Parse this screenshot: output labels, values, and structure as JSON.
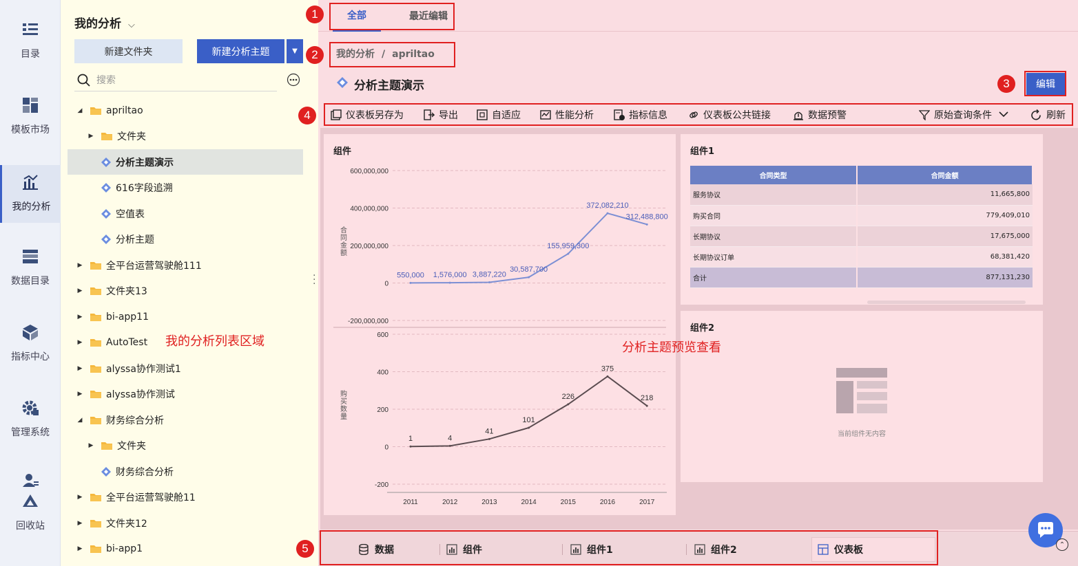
{
  "nav": {
    "items": [
      {
        "label": "目录",
        "icon": "list-icon"
      },
      {
        "label": "模板市场",
        "icon": "template-grid-icon"
      },
      {
        "label": "我的分析",
        "icon": "analysis-chart-icon",
        "active": true
      },
      {
        "label": "数据目录",
        "icon": "database-catalog-icon"
      },
      {
        "label": "指标中心",
        "icon": "metrics-cube-icon"
      },
      {
        "label": "管理系统",
        "icon": "gear-icon"
      },
      {
        "label": "回收站",
        "icon": "recycle-bin-icon"
      }
    ]
  },
  "panel": {
    "title": "我的分析",
    "new_folder_label": "新建文件夹",
    "new_subject_label": "新建分析主题",
    "search_placeholder": "搜索",
    "region_annotation": "我的分析列表区域",
    "tree": [
      {
        "label": "apriltao",
        "type": "folder",
        "expanded": true,
        "depth": 0
      },
      {
        "label": "文件夹",
        "type": "folder",
        "expanded": false,
        "depth": 1
      },
      {
        "label": "分析主题演示",
        "type": "subject",
        "selected": true,
        "depth": 1
      },
      {
        "label": "616字段追溯",
        "type": "subject",
        "depth": 1
      },
      {
        "label": "空值表",
        "type": "subject",
        "depth": 1
      },
      {
        "label": "分析主题",
        "type": "subject",
        "depth": 1
      },
      {
        "label": "全平台运营驾驶舱111",
        "type": "folder",
        "expanded": false,
        "depth": 0
      },
      {
        "label": "文件夹13",
        "type": "folder",
        "expanded": false,
        "depth": 0
      },
      {
        "label": "bi-app11",
        "type": "folder",
        "expanded": false,
        "depth": 0
      },
      {
        "label": "AutoTest",
        "type": "folder",
        "expanded": false,
        "depth": 0
      },
      {
        "label": "alyssa协作测试1",
        "type": "folder",
        "expanded": false,
        "depth": 0
      },
      {
        "label": "alyssa协作测试",
        "type": "folder",
        "expanded": false,
        "depth": 0
      },
      {
        "label": "财务综合分析",
        "type": "folder",
        "expanded": true,
        "depth": 0
      },
      {
        "label": "文件夹",
        "type": "folder",
        "expanded": false,
        "depth": 1
      },
      {
        "label": "财务综合分析",
        "type": "subject",
        "depth": 1
      },
      {
        "label": "全平台运营驾驶舱11",
        "type": "folder",
        "expanded": false,
        "depth": 0
      },
      {
        "label": "文件夹12",
        "type": "folder",
        "expanded": false,
        "depth": 0
      },
      {
        "label": "bi-app1",
        "type": "folder",
        "expanded": false,
        "depth": 0
      }
    ]
  },
  "tabs": [
    {
      "label": "全部",
      "active": true
    },
    {
      "label": "最近编辑",
      "active": false
    }
  ],
  "breadcrumb": {
    "root": "我的分析",
    "sep": "/",
    "current": "apriltao"
  },
  "subject_title": "分析主题演示",
  "edit_label": "编辑",
  "toolbar": {
    "items": [
      {
        "label": "仪表板另存为",
        "icon": "save-as-icon"
      },
      {
        "label": "导出",
        "icon": "export-icon"
      },
      {
        "label": "自适应",
        "icon": "fit-screen-icon"
      },
      {
        "label": "性能分析",
        "icon": "performance-icon"
      },
      {
        "label": "指标信息",
        "icon": "metric-info-icon"
      },
      {
        "label": "仪表板公共链接",
        "icon": "link-icon"
      },
      {
        "label": "数据预警",
        "icon": "alarm-icon"
      }
    ],
    "filter_label": "原始查询条件",
    "refresh_label": "刷新"
  },
  "preview_annotation": "分析主题预览查看",
  "widget_chart": {
    "title": "组件"
  },
  "widget_table": {
    "title": "组件1",
    "headers": [
      "合同类型",
      "合同金额"
    ],
    "rows": [
      [
        "服务协议",
        "11,665,800"
      ],
      [
        "购买合同",
        "779,409,010"
      ],
      [
        "长期协议",
        "17,675,000"
      ],
      [
        "长期协议订单",
        "68,381,420"
      ]
    ],
    "total": [
      "合计",
      "877,131,230"
    ]
  },
  "widget_empty": {
    "title": "组件2",
    "empty_text": "当前组件无内容"
  },
  "bottom_tabs": [
    {
      "label": "数据",
      "icon": "database-icon"
    },
    {
      "label": "组件",
      "icon": "chart-bar-icon"
    },
    {
      "label": "组件1",
      "icon": "chart-bar-icon"
    },
    {
      "label": "组件2",
      "icon": "chart-bar-icon"
    },
    {
      "label": "仪表板",
      "icon": "dashboard-icon",
      "active": true
    }
  ],
  "annotations": [
    "1",
    "2",
    "3",
    "4",
    "5"
  ],
  "colors": {
    "accent": "#3a5fc7",
    "annotation": "#e02020",
    "line_top": "#7c8fd4",
    "line_bottom": "#5a4c50"
  },
  "chart_data": [
    {
      "type": "line",
      "categories": [
        "2011",
        "2012",
        "2013",
        "2014",
        "2015",
        "2016",
        "2017"
      ],
      "series": [
        {
          "values": [
            550000,
            1576000,
            3887220,
            30587700,
            155959300,
            372082210,
            312488800
          ]
        }
      ],
      "data_labels": [
        "550,000",
        "1,576,000",
        "3,887,220",
        "30,587,700",
        "155,959,300",
        "372,082,210",
        "312,488,800"
      ],
      "ylabel": "合同金额",
      "ylim": [
        -200000000,
        600000000
      ],
      "yticks": [
        "-200,000,000",
        "0",
        "200,000,000",
        "400,000,000",
        "600,000,000"
      ],
      "ytick_values": [
        -200000000,
        0,
        200000000,
        400000000,
        600000000
      ],
      "grid": true
    },
    {
      "type": "line",
      "categories": [
        "2011",
        "2012",
        "2013",
        "2014",
        "2015",
        "2016",
        "2017"
      ],
      "series": [
        {
          "values": [
            1,
            4,
            41,
            101,
            226,
            375,
            218
          ]
        }
      ],
      "data_labels": [
        "1",
        "4",
        "41",
        "101",
        "226",
        "375",
        "218"
      ],
      "ylabel": "购买数量",
      "ylim": [
        -200,
        600
      ],
      "yticks": [
        "-200",
        "0",
        "200",
        "400",
        "600"
      ],
      "ytick_values": [
        -200,
        0,
        200,
        400,
        600
      ],
      "grid": true
    }
  ]
}
